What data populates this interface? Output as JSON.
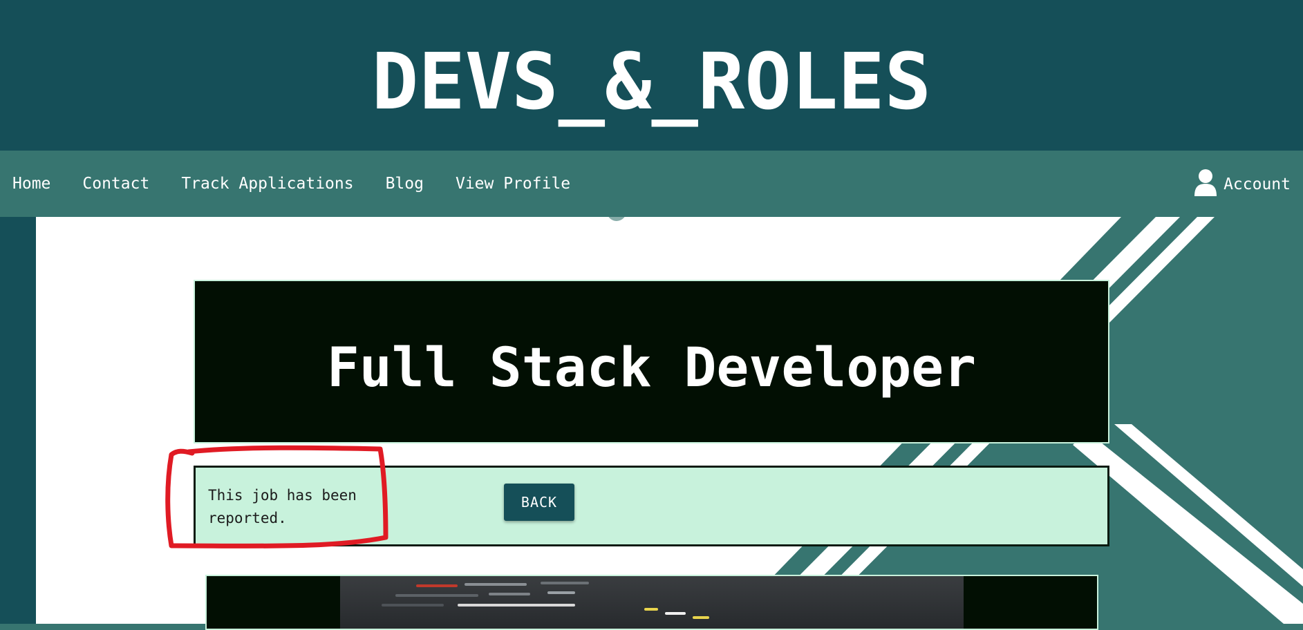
{
  "header": {
    "site_title": "DEVS_&_ROLES"
  },
  "nav": {
    "links": [
      "Home",
      "Contact",
      "Track Applications",
      "Blog",
      "View Profile"
    ],
    "account_label": "Account"
  },
  "job": {
    "title": "Full Stack Developer",
    "status_message": "This job has been reported.",
    "back_label": "BACK"
  },
  "colors": {
    "header_bg": "#154f58",
    "nav_bg": "#377570",
    "title_box_bg": "#020f03",
    "status_bg": "#c8f2dc",
    "button_bg": "#154f58",
    "annotation": "#e01b24"
  },
  "icons": {
    "account": "user-icon",
    "image": "code-screenshot-image"
  }
}
